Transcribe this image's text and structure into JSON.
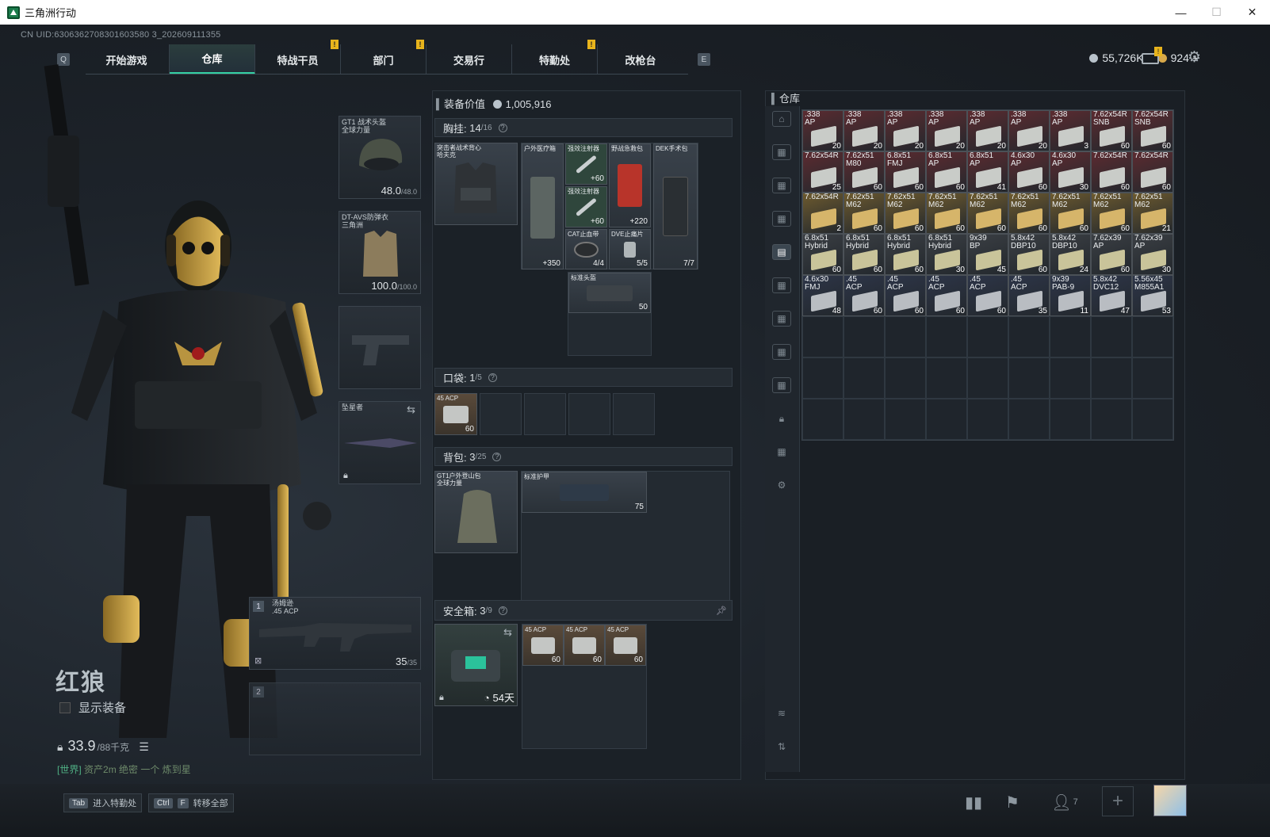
{
  "window": {
    "title": "三角洲行动",
    "controls": [
      "—",
      "☐",
      "✕"
    ]
  },
  "uid": "CN UID:6306362708301603580 3_202609111355",
  "nav": {
    "key_left": "Q",
    "key_right": "E",
    "tabs": [
      {
        "label": "开始游戏",
        "active": false,
        "alert": false
      },
      {
        "label": "仓库",
        "active": true,
        "alert": false
      },
      {
        "label": "特战干员",
        "active": false,
        "alert": true
      },
      {
        "label": "部门",
        "active": false,
        "alert": true
      },
      {
        "label": "交易行",
        "active": false,
        "alert": false
      },
      {
        "label": "特勤处",
        "active": false,
        "alert": true
      },
      {
        "label": "改枪台",
        "active": false,
        "alert": false
      }
    ],
    "alert_mark": "!"
  },
  "currency": {
    "silver": "55,726K",
    "gold": "924",
    "plus": "+"
  },
  "colors": {
    "accent": "#34d0a4",
    "alert": "#e8b41c",
    "ammo_red": "#5c2b30",
    "ammo_gold": "#6d5a2e",
    "ammo_gray": "#3b3f44",
    "ammo_blue": "#2d3548"
  },
  "character": {
    "name": "红狼",
    "show_gear_label": "显示装备",
    "weight": "33.9",
    "weight_max": "/88千克",
    "chat_tag": "[世界]",
    "chat_text": "资产2m   绝密 一个  炼到星"
  },
  "equip": {
    "helmet": {
      "name": "GT1 战术头盔",
      "sub": "全球力量",
      "durability": "48.0",
      "max": "/48.0"
    },
    "armor": {
      "name": "DT-AVS防弹衣",
      "sub": "三角洲",
      "durability": "100.0",
      "max": "/100.0"
    },
    "melee": {
      "name": "坠星者"
    },
    "primary": {
      "index": "1",
      "name": "汤姆逊",
      "sub": ".45 ACP",
      "ammo": "35",
      "ammo_max": "/35"
    },
    "secondary": {
      "index": "2"
    }
  },
  "middle": {
    "equip_value_label": "装备价值",
    "equip_value": "1,005,916",
    "chest": {
      "label": "胸挂:",
      "count": "14",
      "max": "/16",
      "rig_name": "突击者战术背心",
      "rig_sub": "哈夫克"
    },
    "chest_items": [
      {
        "name": "户外医疗箱",
        "count": "+350"
      },
      {
        "name": "强效注射器",
        "count": "+60"
      },
      {
        "name": "强效注射器",
        "count": "+60"
      },
      {
        "name": "野战急救包",
        "count": "+220"
      },
      {
        "name": "DEK手术包",
        "count": "7/7"
      },
      {
        "name": "CAT止血带",
        "count": "4/4"
      },
      {
        "name": "DVE止痛片",
        "count": "5/5"
      },
      {
        "name": "标准头盔",
        "count": "50"
      }
    ],
    "pocket": {
      "label": "口袋:",
      "count": "1",
      "max": "/5",
      "item_name": "45 ACP",
      "item_count": "60"
    },
    "backpack": {
      "label": "背包:",
      "count": "3",
      "max": "/25",
      "bag_name": "GT1户外登山包",
      "bag_sub": "全球力量",
      "item_name": "标准护甲",
      "item_count": "75"
    },
    "safebox": {
      "label": "安全箱:",
      "count": "3",
      "max": "/9",
      "days": "54天",
      "items": [
        {
          "name": "45 ACP",
          "count": "60"
        },
        {
          "name": "45 ACP",
          "count": "60"
        },
        {
          "name": "45 ACP",
          "count": "60"
        }
      ]
    }
  },
  "storage": {
    "title": "仓库",
    "items": [
      {
        "n": ".338",
        "n2": "AP",
        "c": "20",
        "t": "red"
      },
      {
        "n": ".338",
        "n2": "AP",
        "c": "20",
        "t": "red"
      },
      {
        "n": ".338",
        "n2": "AP",
        "c": "20",
        "t": "red"
      },
      {
        "n": ".338",
        "n2": "AP",
        "c": "20",
        "t": "red"
      },
      {
        "n": ".338",
        "n2": "AP",
        "c": "20",
        "t": "red"
      },
      {
        "n": ".338",
        "n2": "AP",
        "c": "20",
        "t": "red"
      },
      {
        "n": ".338",
        "n2": "AP",
        "c": "3",
        "t": "red"
      },
      {
        "n": "7.62x54R",
        "n2": "SNB",
        "c": "60",
        "t": "red"
      },
      {
        "n": "7.62x54R",
        "n2": "SNB",
        "c": "60",
        "t": "red"
      },
      {
        "n": "7.62x54R",
        "n2": "",
        "c": "25",
        "t": "red"
      },
      {
        "n": "7.62x51",
        "n2": "M80",
        "c": "60",
        "t": "red"
      },
      {
        "n": "6.8x51",
        "n2": "FMJ",
        "c": "60",
        "t": "red"
      },
      {
        "n": "6.8x51",
        "n2": "AP",
        "c": "60",
        "t": "red"
      },
      {
        "n": "6.8x51",
        "n2": "AP",
        "c": "41",
        "t": "red"
      },
      {
        "n": "4.6x30",
        "n2": "AP",
        "c": "60",
        "t": "red"
      },
      {
        "n": "4.6x30",
        "n2": "AP",
        "c": "30",
        "t": "red"
      },
      {
        "n": "7.62x54R",
        "n2": "",
        "c": "60",
        "t": "red"
      },
      {
        "n": "7.62x54R",
        "n2": "",
        "c": "60",
        "t": "red"
      },
      {
        "n": "7.62x54R",
        "n2": "",
        "c": "2",
        "t": "gold"
      },
      {
        "n": "7.62x51",
        "n2": "M62",
        "c": "60",
        "t": "gold"
      },
      {
        "n": "7.62x51",
        "n2": "M62",
        "c": "60",
        "t": "gold"
      },
      {
        "n": "7.62x51",
        "n2": "M62",
        "c": "60",
        "t": "gold"
      },
      {
        "n": "7.62x51",
        "n2": "M62",
        "c": "60",
        "t": "gold"
      },
      {
        "n": "7.62x51",
        "n2": "M62",
        "c": "60",
        "t": "gold"
      },
      {
        "n": "7.62x51",
        "n2": "M62",
        "c": "60",
        "t": "gold"
      },
      {
        "n": "7.62x51",
        "n2": "M62",
        "c": "60",
        "t": "gold"
      },
      {
        "n": "7.62x51",
        "n2": "M62",
        "c": "21",
        "t": "gold"
      },
      {
        "n": "6.8x51",
        "n2": "Hybrid",
        "c": "60",
        "t": "gray"
      },
      {
        "n": "6.8x51",
        "n2": "Hybrid",
        "c": "60",
        "t": "gray"
      },
      {
        "n": "6.8x51",
        "n2": "Hybrid",
        "c": "60",
        "t": "gray"
      },
      {
        "n": "6.8x51",
        "n2": "Hybrid",
        "c": "30",
        "t": "gray"
      },
      {
        "n": "9x39",
        "n2": "BP",
        "c": "45",
        "t": "gray"
      },
      {
        "n": "5.8x42",
        "n2": "DBP10",
        "c": "60",
        "t": "gray"
      },
      {
        "n": "5.8x42",
        "n2": "DBP10",
        "c": "24",
        "t": "gray"
      },
      {
        "n": "7.62x39",
        "n2": "AP",
        "c": "60",
        "t": "gray"
      },
      {
        "n": "7.62x39",
        "n2": "AP",
        "c": "30",
        "t": "gray"
      },
      {
        "n": "4.6x30",
        "n2": "FMJ",
        "c": "48",
        "t": "blue"
      },
      {
        "n": ".45",
        "n2": "ACP",
        "c": "60",
        "t": "blue"
      },
      {
        "n": ".45",
        "n2": "ACP",
        "c": "60",
        "t": "blue"
      },
      {
        "n": ".45",
        "n2": "ACP",
        "c": "60",
        "t": "blue"
      },
      {
        "n": ".45",
        "n2": "ACP",
        "c": "60",
        "t": "blue"
      },
      {
        "n": ".45",
        "n2": "ACP",
        "c": "35",
        "t": "blue"
      },
      {
        "n": "9x39",
        "n2": "PAB-9",
        "c": "11",
        "t": "blue"
      },
      {
        "n": "5.8x42",
        "n2": "DVC12",
        "c": "47",
        "t": "blue"
      },
      {
        "n": "5.56x45",
        "n2": "M855A1",
        "c": "53",
        "t": "blue"
      }
    ]
  },
  "bottom": {
    "hint1_key": "Tab",
    "hint1_label": "进入特勤处",
    "hint2_key1": "Ctrl",
    "hint2_key2": "F",
    "hint2_label": "转移全部",
    "friends_count": "7",
    "plus": "+"
  }
}
